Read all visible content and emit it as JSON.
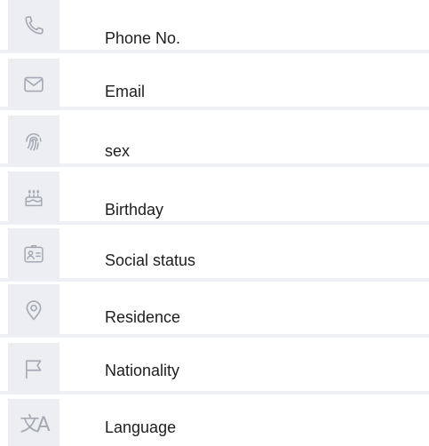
{
  "fields": [
    {
      "label": "Phone No.",
      "icon": "phone-icon"
    },
    {
      "label": "Email",
      "icon": "mail-icon"
    },
    {
      "label": "sex",
      "icon": "fingerprint-icon"
    },
    {
      "label": "Birthday",
      "icon": "cake-icon"
    },
    {
      "label": "Social status",
      "icon": "id-card-icon"
    },
    {
      "label": "Residence",
      "icon": "location-pin-icon"
    },
    {
      "label": "Nationality",
      "icon": "flag-icon"
    },
    {
      "label": "Language",
      "icon": "translate-icon"
    }
  ],
  "colors": {
    "icon_tile": "#eceef2",
    "icon_stroke": "#a5a9b4",
    "row_separator": "#eef0f5",
    "text": "#1e1e1e"
  }
}
